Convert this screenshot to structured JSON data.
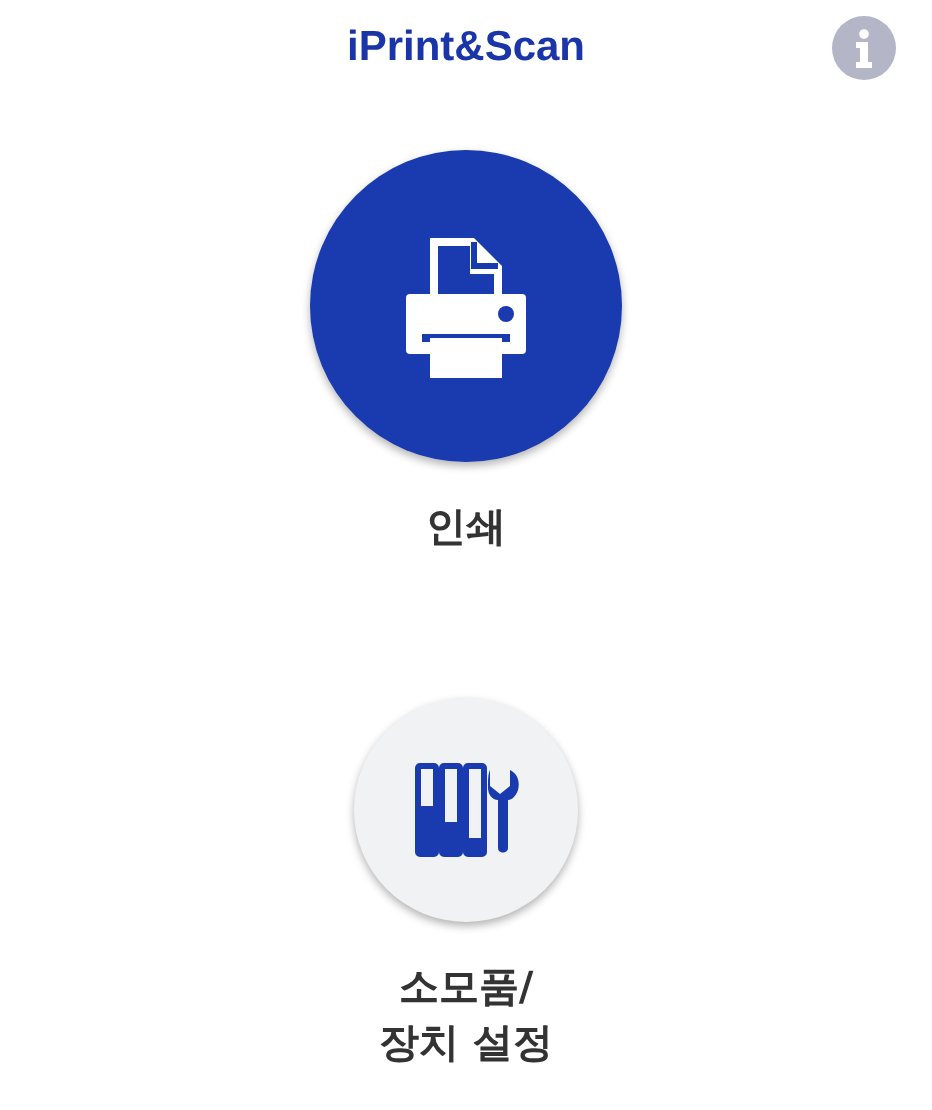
{
  "header": {
    "title": "iPrint&Scan"
  },
  "actions": [
    {
      "kind": "print",
      "label": "인쇄"
    },
    {
      "kind": "supplies",
      "label": "소모품/\n장치 설정"
    }
  ]
}
